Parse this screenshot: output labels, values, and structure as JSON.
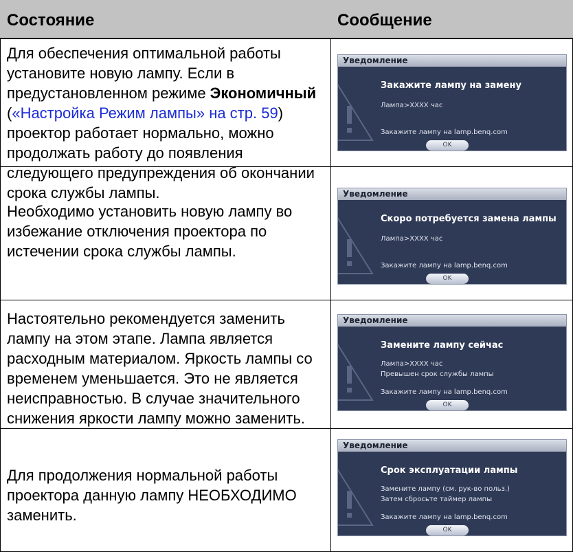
{
  "header": {
    "col_state": "Состояние",
    "col_message": "Сообщение"
  },
  "rows": [
    {
      "desc_part1": "Для обеспечения оптимальной работы установите новую лампу. Если в предустановленном режиме ",
      "desc_bold": "Экономичный",
      "desc_part2": " (",
      "desc_link": "«Настройка Режим лампы» на стр. 59",
      "desc_part3": ") проектор работает нормально, можно продолжать работу до появления следующего предупреждения об окончании срока службы лампы.",
      "dialog": {
        "bar_title": "Уведомление",
        "title": "Закажите лампу на замену",
        "lines": [
          "Лампа>XXXX час"
        ],
        "footer": "Закажите лампу на lamp.benq.com",
        "ok_label": "OK"
      }
    },
    {
      "desc": "Необходимо установить новую лампу во избежание отключения проектора по истечении срока службы лампы.",
      "dialog": {
        "bar_title": "Уведомление",
        "title": "Скоро потребуется замена лампы",
        "lines": [
          "Лампа>XXXX час"
        ],
        "footer": "Закажите лампу на lamp.benq.com",
        "ok_label": "OK"
      }
    },
    {
      "desc": "Настоятельно рекомендуется заменить лампу на этом этапе. Лампа является расходным материалом. Яркость лампы со временем уменьшается. Это не является неисправностью. В случае значительного снижения яркости лампу можно заменить.",
      "dialog": {
        "bar_title": "Уведомление",
        "title": "Замените лампу сейчас",
        "lines": [
          "Лампа>XXXX час",
          "Превышен срок службы лампы"
        ],
        "footer": "Закажите лампу на lamp.benq.com",
        "ok_label": "OK"
      }
    },
    {
      "desc": "Для продолжения нормальной работы проектора данную лампу НЕОБХОДИМО заменить.",
      "dialog": {
        "bar_title": "Уведомление",
        "title": "Срок эксплуатации лампы",
        "lines": [
          "Замените лампу (см. рук-во польз.)",
          "Затем сбросьте таймер лампы"
        ],
        "footer": "Закажите лампу на lamp.benq.com",
        "ok_label": "OK"
      }
    }
  ]
}
